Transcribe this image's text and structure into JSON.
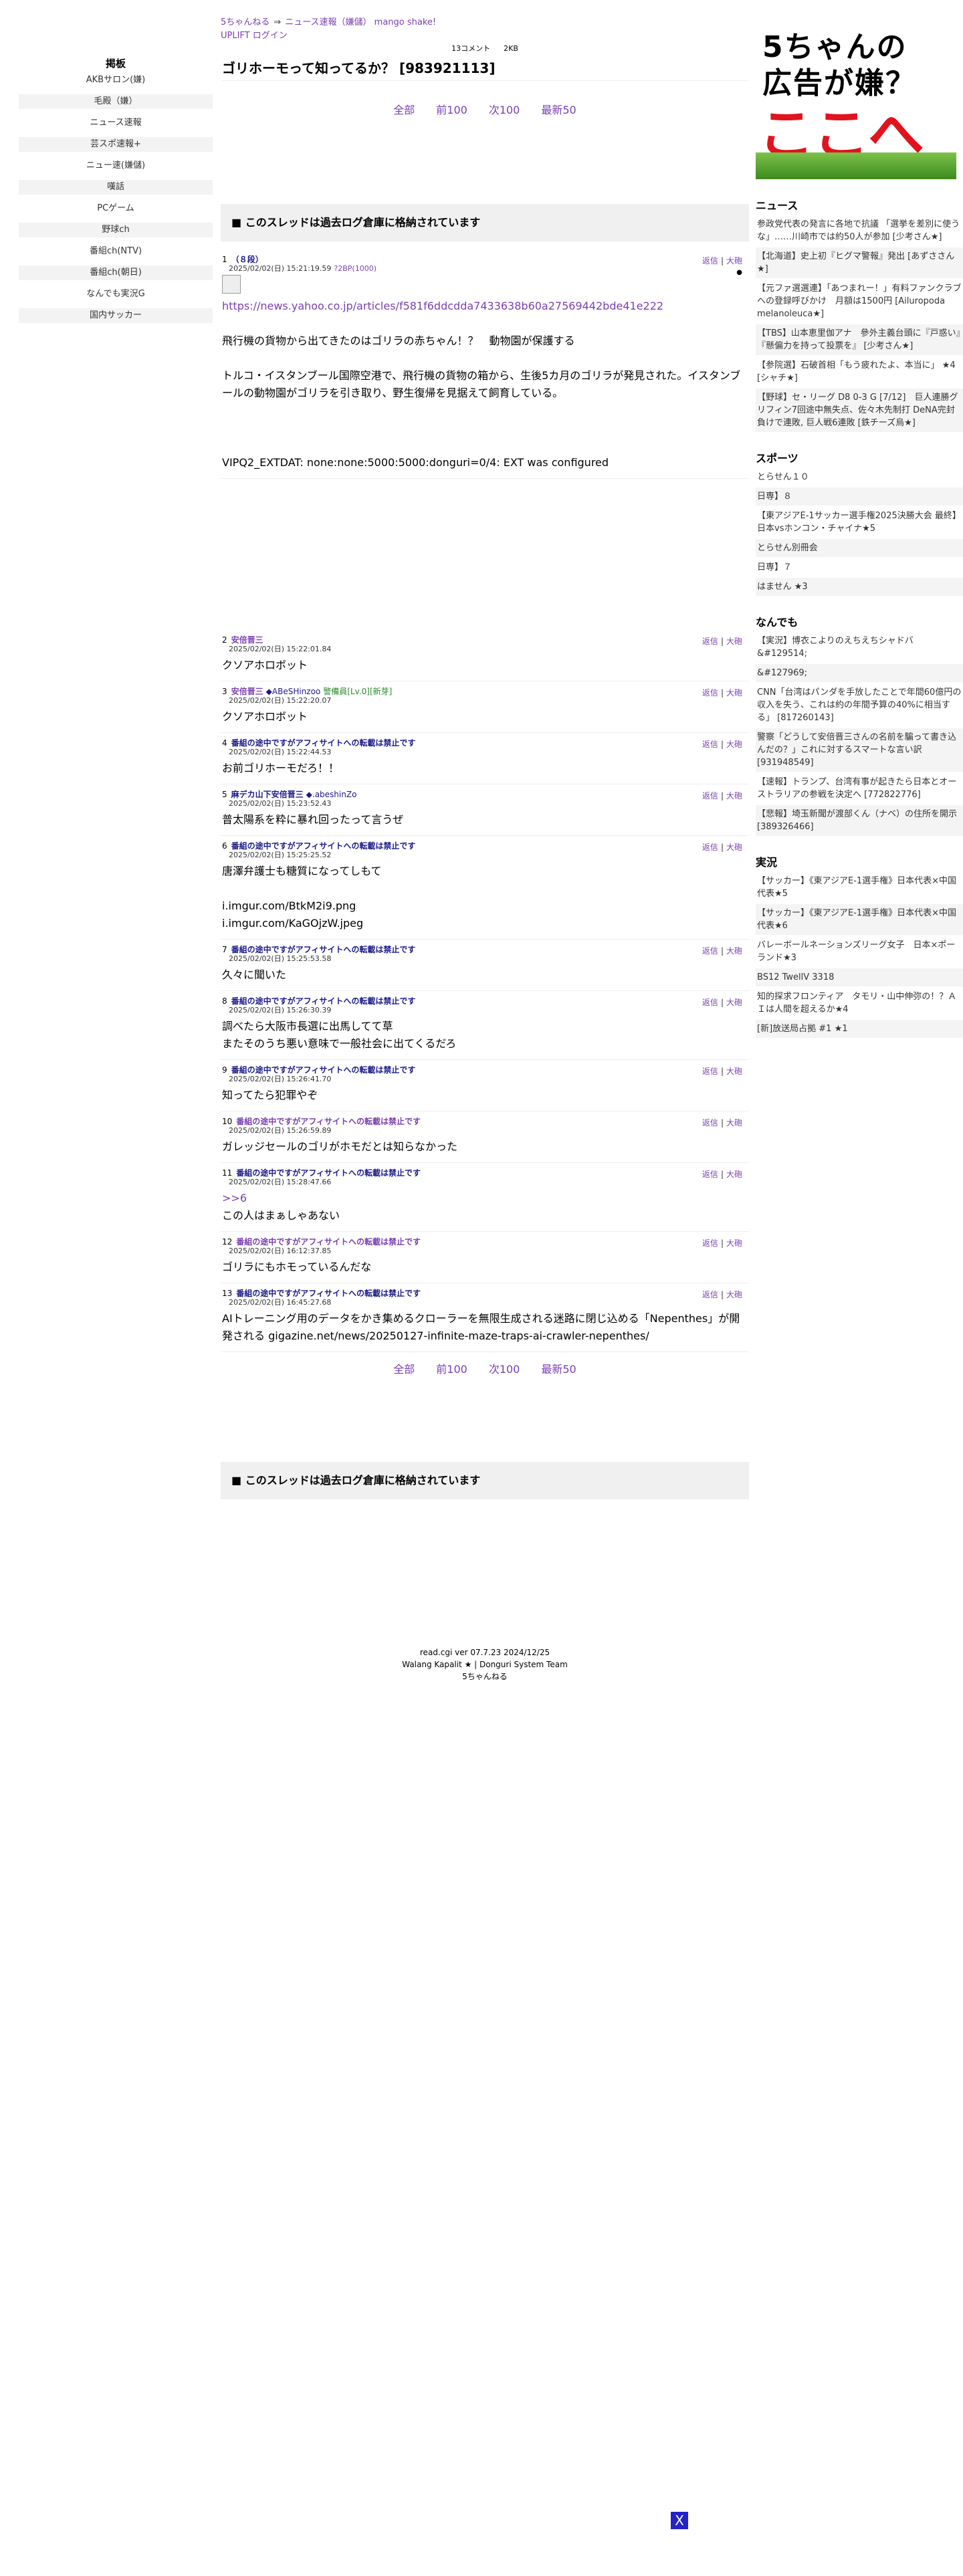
{
  "breadcrumb": {
    "site": "5ちゃんねる",
    "arrow": "⇒",
    "board": "ニュース速報（嫌儲） mango shake!"
  },
  "login_label": "UPLIFT ログイン",
  "thread_meta": {
    "count": "13コメント",
    "size": "2KB"
  },
  "thread_title": "ゴリホーモって知ってるか？ [983921113]",
  "pager": [
    "全部",
    "前100",
    "次100",
    "最新50"
  ],
  "archive_notice": "■ このスレッドは過去ログ倉庫に格納されています",
  "sidebar": {
    "heading": "掲板",
    "items": [
      "AKBサロン(嫌)",
      "毛殿（嫌）",
      "ニュース速報",
      "芸スポ速報+",
      "ニュー速(嫌儲)",
      "嘆話",
      "PCゲーム",
      "野球ch",
      "番組ch(NTV)",
      "番組ch(朝日)",
      "なんでも実況G",
      "国内サッカー"
    ]
  },
  "post_actions": {
    "reply": "返信",
    "sep": "|",
    "more": "大砲"
  },
  "posts": [
    {
      "num": "1",
      "name": "（８段）",
      "trip": "",
      "badge": "",
      "date": "2025/02/02(日) 15:21:19.59",
      "id": "?2BP(1000)",
      "icon": "sssp-icon-placeholder",
      "body": [
        "https://news.yahoo.co.jp/articles/f581f6ddcdda7433638b60a27569442bde41e222",
        "",
        "飛行機の貨物から出てきたのはゴリラの赤ちゃん！？　動物園が保護する",
        "",
        "トルコ・イスタンブール国際空港で、飛行機の貨物の箱から、生後5カ月のゴリラが発見された。イスタンブールの動物園がゴリラを引き取り、野生復帰を見据えて飼育している。",
        "",
        "",
        "",
        "VIPQ2_EXTDAT: none:none:5000:5000:donguri=0/4: EXT was configured"
      ]
    },
    {
      "num": "2",
      "name": "安倍晋三",
      "trip": "",
      "badge": "",
      "date": "2025/02/02(日) 15:22:01.84",
      "id": "",
      "body": [
        "クソアホロボット"
      ]
    },
    {
      "num": "3",
      "name": "安倍晋三",
      "trip": "◆ABeSHinzoo",
      "badge": "警備員[Lv.0][新芽]",
      "date": "2025/02/02(日) 15:22:20.07",
      "id": "",
      "body": [
        "クソアホロボット"
      ]
    },
    {
      "num": "4",
      "name": "番組の途中ですがアフィサイトへの転載は禁止です",
      "trip": "",
      "badge": "",
      "date": "2025/02/02(日) 15:22:44.53",
      "id": "",
      "body": [
        "お前ゴリホーモだろ！！"
      ]
    },
    {
      "num": "5",
      "name": "麻デカ山下安倍晋三",
      "trip": "◆.abeshinZo",
      "badge": "",
      "date": "2025/02/02(日) 15:23:52.43",
      "id": "",
      "body": [
        "普太陽系を粋に暴れ回ったって言うぜ"
      ]
    },
    {
      "num": "6",
      "name": "番組の途中ですがアフィサイトへの転載は禁止です",
      "trip": "",
      "badge": "",
      "date": "2025/02/02(日) 15:25:25.52",
      "id": "",
      "body": [
        "唐澤弁護士も糖質になってしもて",
        "",
        "i.imgur.com/BtkM2i9.png",
        "i.imgur.com/KaGOjzW.jpeg"
      ]
    },
    {
      "num": "7",
      "name": "番組の途中ですがアフィサイトへの転載は禁止です",
      "trip": "",
      "badge": "",
      "date": "2025/02/02(日) 15:25:53.58",
      "id": "",
      "body": [
        "久々に聞いた"
      ]
    },
    {
      "num": "8",
      "name": "番組の途中ですがアフィサイトへの転載は禁止です",
      "trip": "",
      "badge": "",
      "date": "2025/02/02(日) 15:26:30.39",
      "id": "",
      "body": [
        "調べたら大阪市長選に出馬してて草",
        "またそのうち悪い意味で一般社会に出てくるだろ"
      ]
    },
    {
      "num": "9",
      "name": "番組の途中ですがアフィサイトへの転載は禁止です",
      "trip": "",
      "badge": "",
      "date": "2025/02/02(日) 15:26:41.70",
      "id": "",
      "body": [
        "知ってたら犯罪やぞ"
      ]
    },
    {
      "num": "10",
      "name": "番組の途中ですがアフィサイトへの転載は禁止です",
      "trip": "",
      "badge": "",
      "date": "2025/02/02(日) 15:26:59.89",
      "id": "",
      "body": [
        "ガレッジセールのゴリがホモだとは知らなかった"
      ]
    },
    {
      "num": "11",
      "name": "番組の途中ですがアフィサイトへの転載は禁止です",
      "trip": "",
      "badge": "",
      "date": "2025/02/02(日) 15:28:47.66",
      "id": "",
      "body": [
        ">>6",
        "この人はまぁしゃあない"
      ]
    },
    {
      "num": "12",
      "name": "番組の途中ですがアフィサイトへの転載は禁止です",
      "trip": "",
      "badge": "",
      "date": "2025/02/02(日) 16:12:37.85",
      "id": "",
      "body": [
        "ゴリラにもホモっているんだな"
      ]
    },
    {
      "num": "13",
      "name": "番組の途中ですがアフィサイトへの転載は禁止です",
      "trip": "",
      "badge": "",
      "date": "2025/02/02(日) 16:45:27.68",
      "id": "",
      "body": [
        "AIトレーニング用のデータをかき集めるクローラーを無限生成される迷路に閉じ込める「Nepenthes」が開発される gigazine.net/news/20250127-infinite-maze-traps-ai-crawler-nepenthes/"
      ]
    }
  ],
  "footer": [
    "read.cgi ver 07.7.23 2024/12/25",
    "Walang Kapalit ★ | Donguri System Team",
    "5ちゃんねる"
  ],
  "ad": {
    "line1": "5ちゃんの",
    "line2": "広告が嫌？",
    "line3": "ここへ"
  },
  "right_sections": [
    {
      "heading": "ニュース",
      "items": [
        "参政党代表の発言に各地で抗議 「選挙を差別に使うな」……川崎市では約50人が参加 [少考さん★]",
        "【北海道】史上初『ヒグマ警報』発出 [あずささん★]",
        "【元ファ選選連】「あつまれー！」有料ファンクラブへの登録呼びかけ　月額は1500円 [Ailuropoda melanoleuca★]",
        "【TBS】山本恵里伽アナ　參外主義台頭に『戸惑い』『懸偏力を持って投票を』 [少考さん★]",
        "【参院選】石破首相「もう疲れたよ、本当に」 ★4 [シャチ★]",
        "【野球】セ・リーグ D8 0-3 G [7/12]　巨人連勝グリフィン7回途中無失点、佐々木先制打 DeNA完封負けで連敗, 巨人戦6連敗 [鉄チーズ烏★]"
      ]
    },
    {
      "heading": "スポーツ",
      "items": [
        "とらせん１０",
        "日専】８",
        "【東アジアE-1サッカー選手権2025決勝大会 最終】日本vsホンコン・チャイナ★5",
        "とらせん別冊会",
        "日専】７",
        "はません ★3"
      ]
    },
    {
      "heading": "なんでも",
      "items": [
        "【実況】博衣こよりのえちえちシャドバ&#129514;",
        "&#127969;",
        "CNN「台湾はパンダを手放したことで年間60億円の収入を失う、これは約の年間予算の40%に相当する」 [817260143]",
        "警察「どうして安倍晋三さんの名前を騙って書き込んだの？」これに対するスマートな言い訳 [931948549]",
        "【速報】トランプ、台湾有事が起きたら日本とオーストラリアの参戦を決定へ [772822776]",
        "【悲報】埼玉新聞が渡部くん（ナベ）の住所を開示 [389326466]"
      ]
    },
    {
      "heading": "実況",
      "items": [
        "【サッカー】《東アジアE-1選手権》日本代表×中国代表★5",
        "【サッカー】《東アジアE-1選手権》日本代表×中国代表★6",
        "バレーボールネーションズリーグ女子　日本×ポーランド★3",
        "BS12 TwellV 3318",
        "知的探求フロンティア　タモリ・山中伸弥の！？ＡＩは人間を超えるか★4",
        "[新]放送局占拠 #1 ★1"
      ]
    }
  ],
  "close_label": "X",
  "colors": {
    "link": "#7a3fb0",
    "archive_bg": "#f0f0f0",
    "ad_red": "#e0141e",
    "close_bg": "#2323c8"
  }
}
